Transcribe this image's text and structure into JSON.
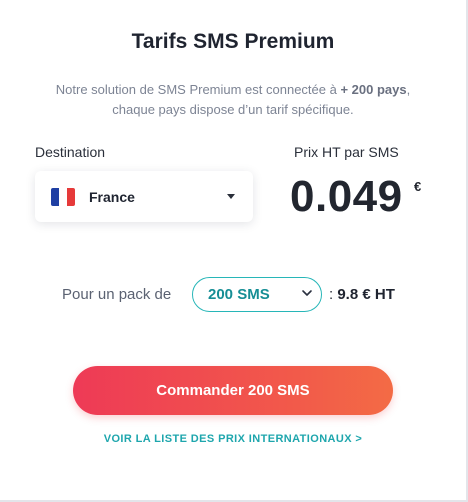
{
  "title": "Tarifs SMS Premium",
  "subtitle": {
    "line1_pre": "Notre solution de SMS Premium est connectée à ",
    "line1_bold": "+ 200 pays",
    "line1_post": ",",
    "line2": "chaque pays dispose d’un tarif spécifique."
  },
  "destination": {
    "label": "Destination",
    "value": "France",
    "flag_icon": "france-flag-icon",
    "flag_colors": [
      "#1f3fa3",
      "#ffffff",
      "#e63a3a"
    ]
  },
  "price": {
    "label": "Prix HT par SMS",
    "value": "0.049",
    "currency": "€"
  },
  "pack": {
    "label": "Pour un pack de",
    "value": "200 SMS",
    "chevron": "⌄",
    "separator": ":",
    "total": "9.8 € HT"
  },
  "order_button": "Commander 200 SMS",
  "intl_link": "VOIR LA LISTE DES PRIX INTERNATIONAUX >",
  "colors": {
    "accent_teal": "#1ea6ad",
    "button_red": "#ee3a56",
    "button_orange": "#f36b45"
  }
}
